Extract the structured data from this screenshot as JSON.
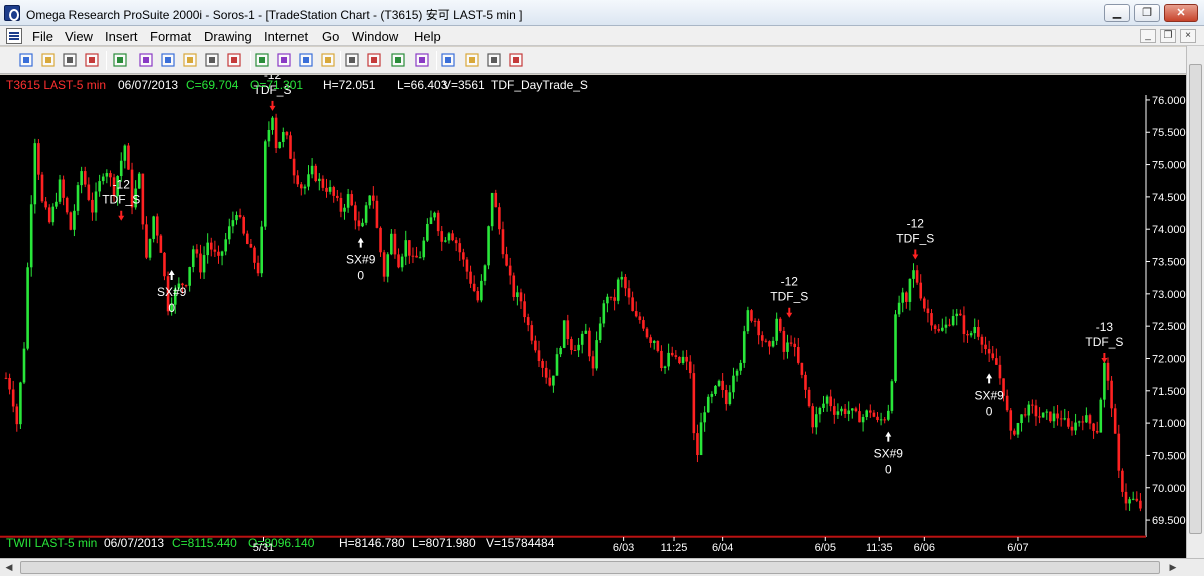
{
  "window": {
    "title": "Omega Research ProSuite 2000i - Soros-1 - [TradeStation Chart - (T3615) 安可 LAST-5 min ]",
    "min_glyph": "▁",
    "max_glyph": "❐",
    "close_glyph": "✕"
  },
  "menu": {
    "items": [
      "File",
      "View",
      "Insert",
      "Format",
      "Drawing",
      "Internet",
      "Go",
      "Window",
      "Help"
    ],
    "mdi_min": "_",
    "mdi_restore": "❐",
    "mdi_close": "×"
  },
  "toolbar": {
    "icons": [
      "new-icon",
      "open-icon",
      "save-workspace-icon",
      "close-icon",
      "print-icon",
      "format-icon",
      "scroll-left-icon",
      "scroll-right-icon",
      "bar-spacing-icon",
      "insert-indicator-icon",
      "insert-strategy-icon",
      "data-window-icon",
      "chart-analysis-icon",
      "news-icon",
      "compress-icon",
      "expand-icon",
      "zoom-in-icon",
      "zoom-out-icon",
      "drawing-tools-icon",
      "pointer-icon",
      "g-icon",
      "help-icon"
    ]
  },
  "colors": {
    "background": "#000000",
    "up": "#29e63a",
    "down": "#ff2222",
    "text": "#ffffff",
    "symbol": "#ff3030",
    "close_label": "#29e63a",
    "open_label": "#29e63a",
    "arrow_short": "#ff2222",
    "arrow_cover": "#ffffff"
  },
  "header": {
    "symbol": "T3615 LAST-5 min",
    "date": "06/07/2013",
    "close": "C=69.704",
    "open": "O=71.301",
    "high": "H=72.051",
    "low": "L=66.403",
    "volume": "V=3561",
    "strategy": "TDF_DayTrade_S"
  },
  "subheader": {
    "symbol": "TWII LAST-5 min",
    "date": "06/07/2013",
    "close": "C=8115.440",
    "open": "O=8096.140",
    "high": "H=8146.780",
    "low": "L=8071.980",
    "volume": "V=15784484"
  },
  "chart_data": {
    "type": "candlestick",
    "ylim": [
      69.3,
      76.2
    ],
    "y_ticks": [
      "76.000",
      "75.500",
      "75.000",
      "74.500",
      "74.000",
      "73.500",
      "73.000",
      "72.500",
      "72.000",
      "71.500",
      "71.000",
      "70.500",
      "70.000",
      "69.500"
    ],
    "x_labels": [
      "5/31",
      "6/03",
      "11:25",
      "6/04",
      "6/05",
      "11:35",
      "6/06",
      "6/07"
    ],
    "close_path": [
      [
        0,
        71.7
      ],
      [
        3,
        71.5
      ],
      [
        6,
        71.0
      ],
      [
        10,
        72.2
      ],
      [
        13,
        74.0
      ],
      [
        16,
        75.4
      ],
      [
        20,
        74.4
      ],
      [
        24,
        74.1
      ],
      [
        30,
        74.7
      ],
      [
        36,
        74.0
      ],
      [
        42,
        74.9
      ],
      [
        48,
        74.3
      ],
      [
        55,
        75.0
      ],
      [
        60,
        74.6
      ],
      [
        66,
        75.3
      ],
      [
        70,
        74.4
      ],
      [
        74,
        74.8
      ],
      [
        78,
        73.5
      ],
      [
        82,
        74.2
      ],
      [
        86,
        73.7
      ],
      [
        90,
        72.8
      ],
      [
        95,
        73.1
      ],
      [
        100,
        73.2
      ],
      [
        104,
        73.7
      ],
      [
        108,
        73.4
      ],
      [
        112,
        73.8
      ],
      [
        118,
        73.5
      ],
      [
        124,
        74.0
      ],
      [
        128,
        74.3
      ],
      [
        132,
        73.9
      ],
      [
        138,
        73.5
      ],
      [
        141,
        73.3
      ],
      [
        144,
        75.3
      ],
      [
        148,
        75.8
      ],
      [
        150,
        75.3
      ],
      [
        155,
        75.5
      ],
      [
        160,
        74.9
      ],
      [
        165,
        74.6
      ],
      [
        170,
        74.9
      ],
      [
        175,
        74.7
      ],
      [
        180,
        74.6
      ],
      [
        186,
        74.3
      ],
      [
        190,
        74.5
      ],
      [
        194,
        74.2
      ],
      [
        197,
        73.9
      ],
      [
        200,
        74.3
      ],
      [
        203,
        74.7
      ],
      [
        206,
        74.0
      ],
      [
        210,
        73.3
      ],
      [
        214,
        73.9
      ],
      [
        218,
        73.5
      ],
      [
        222,
        73.8
      ],
      [
        226,
        73.5
      ],
      [
        230,
        73.6
      ],
      [
        234,
        74.0
      ],
      [
        238,
        74.3
      ],
      [
        242,
        73.8
      ],
      [
        246,
        74.0
      ],
      [
        250,
        73.8
      ],
      [
        254,
        73.5
      ],
      [
        258,
        73.2
      ],
      [
        262,
        72.9
      ],
      [
        266,
        73.4
      ],
      [
        270,
        74.6
      ],
      [
        274,
        74.0
      ],
      [
        278,
        73.4
      ],
      [
        282,
        73.0
      ],
      [
        286,
        72.9
      ],
      [
        290,
        72.5
      ],
      [
        294,
        72.2
      ],
      [
        298,
        71.9
      ],
      [
        302,
        71.6
      ],
      [
        306,
        72.0
      ],
      [
        310,
        72.5
      ],
      [
        314,
        72.2
      ],
      [
        318,
        72.2
      ],
      [
        322,
        72.4
      ],
      [
        326,
        71.8
      ],
      [
        330,
        72.6
      ],
      [
        334,
        73.0
      ],
      [
        337,
        72.8
      ],
      [
        341,
        73.3
      ],
      [
        345,
        73.0
      ],
      [
        349,
        72.6
      ],
      [
        353,
        72.6
      ],
      [
        357,
        72.3
      ],
      [
        361,
        72.3
      ],
      [
        365,
        71.8
      ],
      [
        369,
        72.1
      ],
      [
        373,
        71.9
      ],
      [
        376,
        72.0
      ],
      [
        380,
        71.8
      ],
      [
        383,
        70.3
      ],
      [
        387,
        71.2
      ],
      [
        392,
        71.4
      ],
      [
        396,
        71.6
      ],
      [
        400,
        71.3
      ],
      [
        404,
        71.8
      ],
      [
        408,
        72.0
      ],
      [
        412,
        72.7
      ],
      [
        416,
        72.6
      ],
      [
        420,
        72.3
      ],
      [
        424,
        72.1
      ],
      [
        428,
        72.6
      ],
      [
        432,
        72.1
      ],
      [
        436,
        72.3
      ],
      [
        440,
        71.9
      ],
      [
        444,
        71.5
      ],
      [
        448,
        71.0
      ],
      [
        452,
        71.2
      ],
      [
        456,
        71.4
      ],
      [
        460,
        71.2
      ],
      [
        464,
        71.2
      ],
      [
        468,
        71.2
      ],
      [
        472,
        71.1
      ],
      [
        476,
        71.1
      ],
      [
        480,
        71.2
      ],
      [
        484,
        71.0
      ],
      [
        488,
        71.1
      ],
      [
        491,
        71.3
      ],
      [
        494,
        72.6
      ],
      [
        497,
        73.0
      ],
      [
        500,
        72.8
      ],
      [
        503,
        73.4
      ],
      [
        506,
        73.2
      ],
      [
        510,
        72.8
      ],
      [
        514,
        72.6
      ],
      [
        518,
        72.4
      ],
      [
        522,
        72.5
      ],
      [
        526,
        72.7
      ],
      [
        530,
        72.6
      ],
      [
        534,
        72.3
      ],
      [
        538,
        72.5
      ],
      [
        542,
        72.3
      ],
      [
        546,
        72.0
      ],
      [
        550,
        71.9
      ],
      [
        554,
        71.5
      ],
      [
        558,
        70.8
      ],
      [
        562,
        71.0
      ],
      [
        566,
        71.2
      ],
      [
        570,
        71.2
      ],
      [
        574,
        71.1
      ],
      [
        578,
        71.1
      ],
      [
        582,
        71.1
      ],
      [
        586,
        71.1
      ],
      [
        590,
        70.9
      ],
      [
        594,
        71.0
      ],
      [
        598,
        71.1
      ],
      [
        602,
        71.0
      ],
      [
        606,
        70.9
      ],
      [
        610,
        71.9
      ],
      [
        614,
        71.3
      ],
      [
        618,
        70.2
      ],
      [
        622,
        69.8
      ],
      [
        626,
        69.8
      ],
      [
        630,
        69.7
      ]
    ],
    "annotations": [
      {
        "kind": "short",
        "label": "-12",
        "signal": "TDF_S",
        "bar": 64,
        "price": 74.1
      },
      {
        "kind": "cover",
        "label": "SX#9",
        "qty": "0",
        "bar": 92,
        "price": 73.4
      },
      {
        "kind": "short",
        "label": "-12",
        "signal": "TDF_S",
        "bar": 148,
        "price": 75.8
      },
      {
        "kind": "cover",
        "label": "SX#9",
        "qty": "0",
        "bar": 197,
        "price": 73.9
      },
      {
        "kind": "short",
        "label": "-12",
        "signal": "TDF_S",
        "bar": 435,
        "price": 72.6
      },
      {
        "kind": "cover",
        "label": "SX#9",
        "qty": "0",
        "bar": 490,
        "price": 70.9
      },
      {
        "kind": "short",
        "label": "-12",
        "signal": "TDF_S",
        "bar": 505,
        "price": 73.5
      },
      {
        "kind": "cover",
        "label": "SX#9",
        "qty": "0",
        "bar": 546,
        "price": 71.8
      },
      {
        "kind": "short",
        "label": "-13",
        "signal": "TDF_S",
        "bar": 610,
        "price": 71.9
      }
    ]
  },
  "scroll": {
    "left_arrow": "◀",
    "right_arrow": "▶"
  }
}
